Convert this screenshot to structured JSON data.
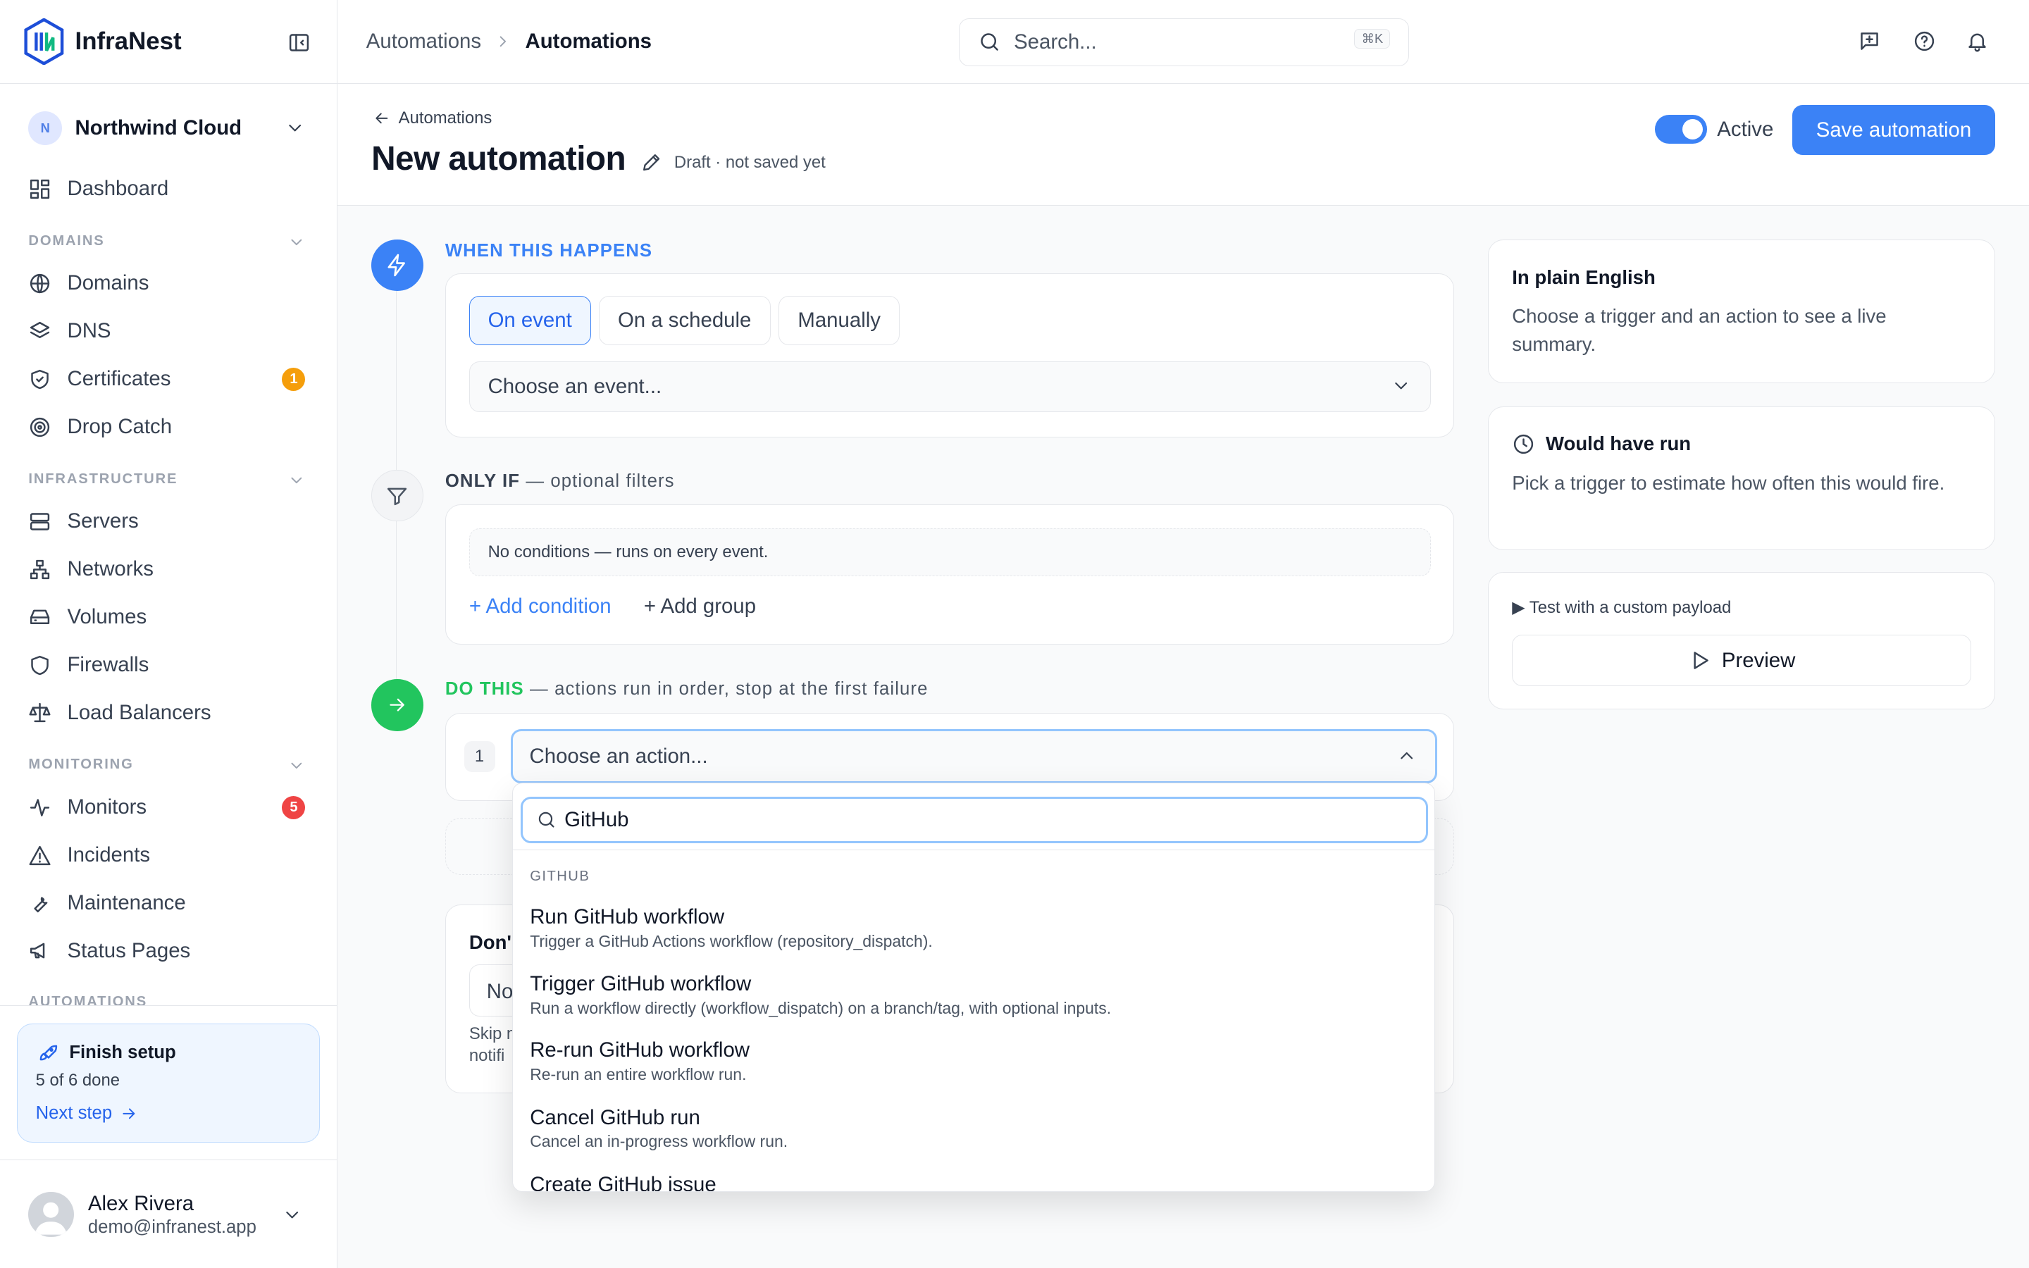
{
  "app": {
    "name": "InfraNest"
  },
  "sidebar": {
    "workspace": {
      "initial": "N",
      "name": "Northwind Cloud"
    },
    "dashboard": "Dashboard",
    "sections": {
      "domains": "DOMAINS",
      "infrastructure": "INFRASTRUCTURE",
      "monitoring": "MONITORING",
      "automations": "AUTOMATIONS"
    },
    "items": {
      "domains": "Domains",
      "dns": "DNS",
      "certificates": "Certificates",
      "drop_catch": "Drop Catch",
      "servers": "Servers",
      "networks": "Networks",
      "volumes": "Volumes",
      "firewalls": "Firewalls",
      "load_balancers": "Load Balancers",
      "monitors": "Monitors",
      "incidents": "Incidents",
      "maintenance": "Maintenance",
      "status_pages": "Status Pages"
    },
    "badges": {
      "certificates": "1",
      "monitors": "5"
    },
    "setup": {
      "title": "Finish setup",
      "progress": "5 of 6 done",
      "next": "Next step"
    },
    "user": {
      "name": "Alex Rivera",
      "email": "demo@infranest.app"
    }
  },
  "topbar": {
    "breadcrumb": [
      "Automations",
      "Automations"
    ],
    "search_placeholder": "Search...",
    "shortcut": "⌘K"
  },
  "header": {
    "back": "Automations",
    "title": "New automation",
    "status": "Draft · not saved yet",
    "active_label": "Active",
    "active": true,
    "save": "Save automation"
  },
  "trigger": {
    "label": "WHEN THIS HAPPENS",
    "tabs": [
      "On event",
      "On a schedule",
      "Manually"
    ],
    "selected_tab": "On event",
    "event_placeholder": "Choose an event..."
  },
  "filters": {
    "label": "ONLY IF",
    "label_suffix": " — optional filters",
    "empty": "No conditions — runs on every event.",
    "add_condition": "+ Add condition",
    "add_group": "+ Add group"
  },
  "actions": {
    "label": "DO THIS",
    "label_suffix": " — actions run in order, stop at the first failure",
    "step_number": "1",
    "placeholder": "Choose an action...",
    "below_title": "Don'",
    "below_input": "No",
    "below_text_1": "Skip n",
    "below_text_2": "notifi"
  },
  "dropdown": {
    "search_value": "GitHub",
    "group": "GITHUB",
    "options": [
      {
        "title": "Run GitHub workflow",
        "desc": "Trigger a GitHub Actions workflow (repository_dispatch)."
      },
      {
        "title": "Trigger GitHub workflow",
        "desc": "Run a workflow directly (workflow_dispatch) on a branch/tag, with optional inputs."
      },
      {
        "title": "Re-run GitHub workflow",
        "desc": "Re-run an entire workflow run."
      },
      {
        "title": "Cancel GitHub run",
        "desc": "Cancel an in-progress workflow run."
      },
      {
        "title": "Create GitHub issue",
        "desc": ""
      }
    ]
  },
  "panel": {
    "english": {
      "title": "In plain English",
      "text": "Choose a trigger and an action to see a live summary."
    },
    "would_run": {
      "title": "Would have run",
      "text": "Pick a trigger to estimate how often this would fire."
    },
    "test": {
      "label": "Test with a custom payload",
      "preview": "Preview"
    }
  },
  "colors": {
    "accent": "#3b82f6",
    "success": "#22c55e",
    "warning": "#f59e0b",
    "danger": "#ef4444"
  }
}
